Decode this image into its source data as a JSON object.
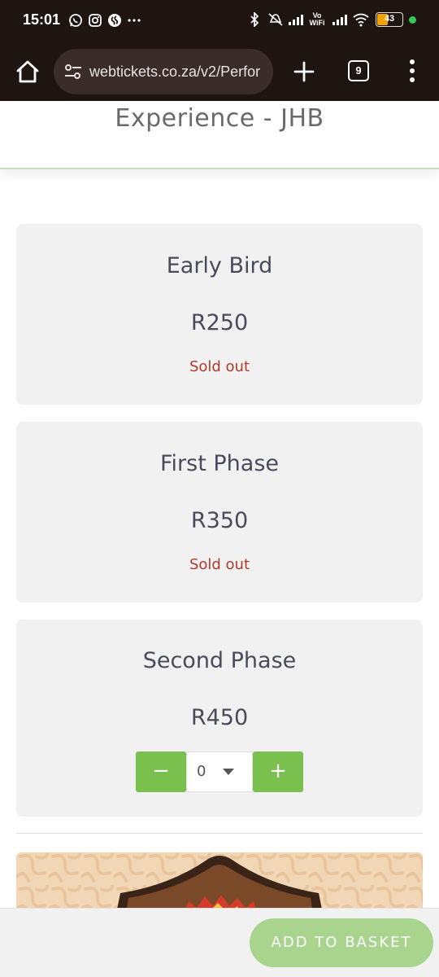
{
  "status_bar": {
    "time": "15:01",
    "battery_level": "43",
    "left_icons": [
      "whatsapp-icon",
      "instagram-icon",
      "shazam-icon",
      "more-dots-icon"
    ],
    "right_icons": [
      "bluetooth-icon",
      "mute-icon",
      "signal-icon",
      "vowifi-icon",
      "signal-icon",
      "wifi-icon",
      "battery-icon"
    ]
  },
  "browser": {
    "url": "webtickets.co.za/v2/Perfor",
    "tab_count": "9"
  },
  "page": {
    "title": "Experience - JHB"
  },
  "tickets": [
    {
      "name": "Early Bird",
      "price": "R250",
      "status": "Sold out"
    },
    {
      "name": "First Phase",
      "price": "R350",
      "status": "Sold out"
    },
    {
      "name": "Second Phase",
      "price": "R450",
      "quantity": "0",
      "minus": "−",
      "plus": "+"
    }
  ],
  "bottom": {
    "add_to_basket": "ADD TO BASKET"
  },
  "colors": {
    "status_bar_bg": "#1e1410",
    "accent_green": "#7ac04f",
    "button_light_green": "#a8d48e",
    "sold_out_red": "#b03a2e",
    "card_bg": "#f1f1f1"
  }
}
